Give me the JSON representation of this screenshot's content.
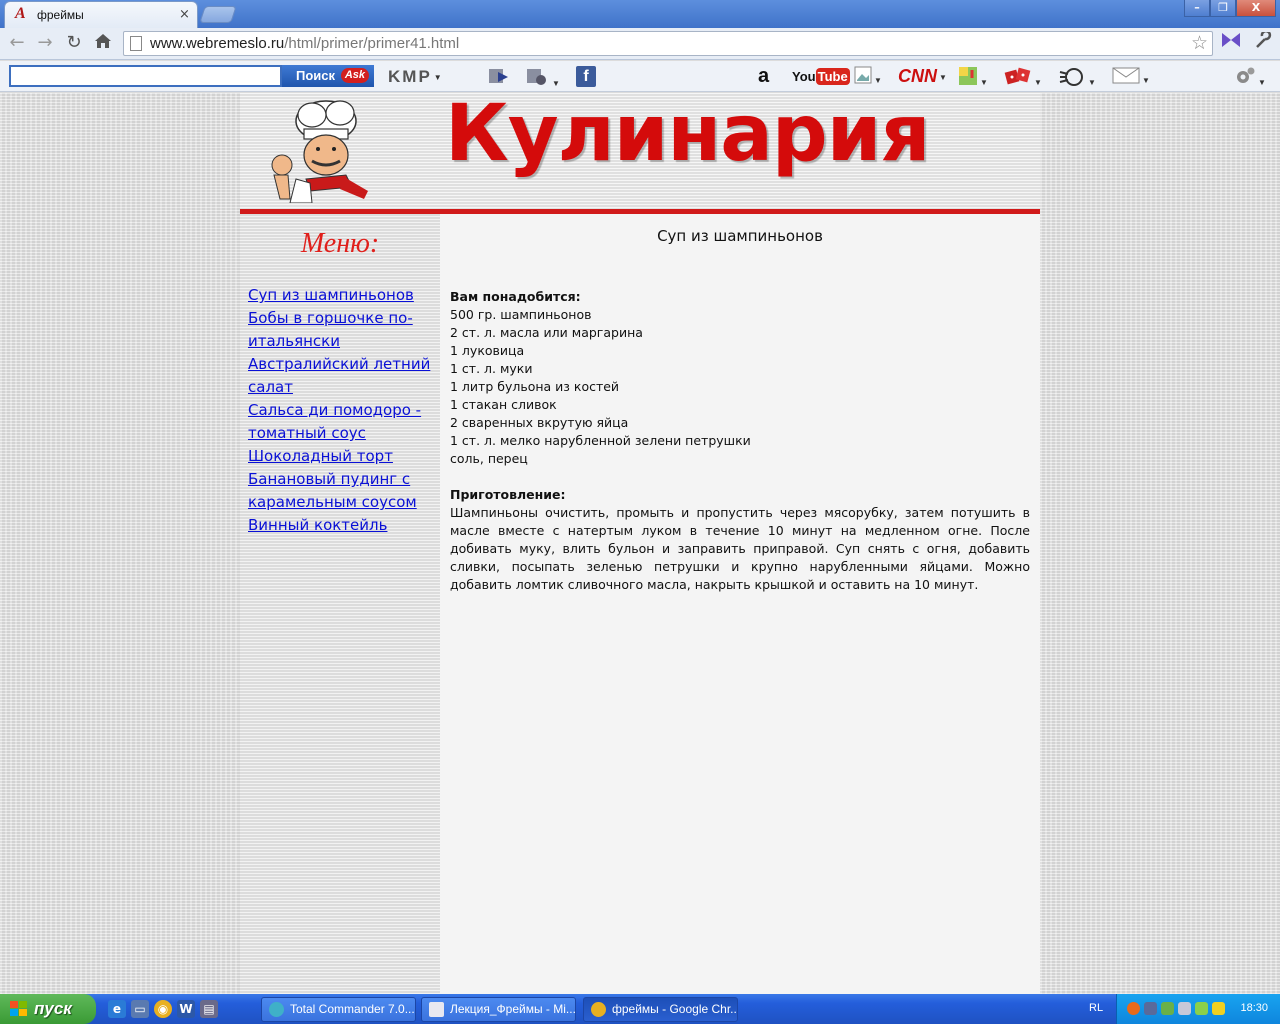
{
  "browser": {
    "tab_title": "фреймы",
    "tab_close": "×",
    "tab_favicon": "A",
    "window_controls": [
      "–",
      "❐",
      "X"
    ],
    "url_host": "www.webremeslo.ru",
    "url_path": "/html/primer/primer41.html",
    "star_icon": "☆"
  },
  "toolbar": {
    "search_value": "",
    "search_button": "Поиск",
    "ask_label": "Ask",
    "kmp_label": "KMP",
    "icons": [
      "media-play-icon",
      "rss-icon",
      "facebook-icon",
      "amazon-icon",
      "youtube-icon",
      "image-icon",
      "cnn-icon",
      "maps-icon",
      "dice-icon",
      "weather-icon",
      "mail-icon",
      "settings-icon"
    ],
    "youtube_label": "YouTube",
    "cnn_label": "CNN",
    "amazon_label": "a",
    "facebook_label": "f"
  },
  "site": {
    "title": "Кулинария",
    "accent_color": "#d40b0b",
    "link_color": "#0a10d6"
  },
  "menu": {
    "title": "Меню:",
    "items": [
      "Суп из шампиньонов",
      "Бобы в горшочке по-итальянски",
      "Австралийский летний салат",
      "Сальса ди помодоро - томатный соус",
      "Шоколадный торт",
      "Банановый пудинг с карамельным соусом",
      "Винный коктейль"
    ]
  },
  "recipe": {
    "title": "Суп из шампиньонов",
    "ingredients_label": "Вам понадобится:",
    "ingredients": [
      "500 гр. шампиньонов",
      "2 ст. л. масла или маргарина",
      "1 луковица",
      "1 ст. л. муки",
      "1 литр бульона из костей",
      "1 стакан сливок",
      "2 сваренных вкрутую яйца",
      "1 ст. л. мелко нарубленной зелени петрушки",
      "соль, перец"
    ],
    "preparation_label": "Приготовление:",
    "preparation": "Шампиньоны очистить, промыть и пропустить через мясорубку, затем потушить в масле вместе с натертым луком в течение 10 минут на медленном огне. После добивать муку, влить бульон и заправить приправой. Суп снять с огня, добавить сливки, посыпать зеленью петрушки и крупно нарубленными яйцами. Можно добавить ломтик сливочного масла, накрыть крышкой и оставить на 10 минут."
  },
  "taskbar": {
    "start_label": "пуск",
    "tasks": [
      "Total Commander 7.0...",
      "Лекция_Фреймы - Mi...",
      "фреймы - Google Chr..."
    ],
    "language": "RL",
    "clock": "18:30"
  }
}
